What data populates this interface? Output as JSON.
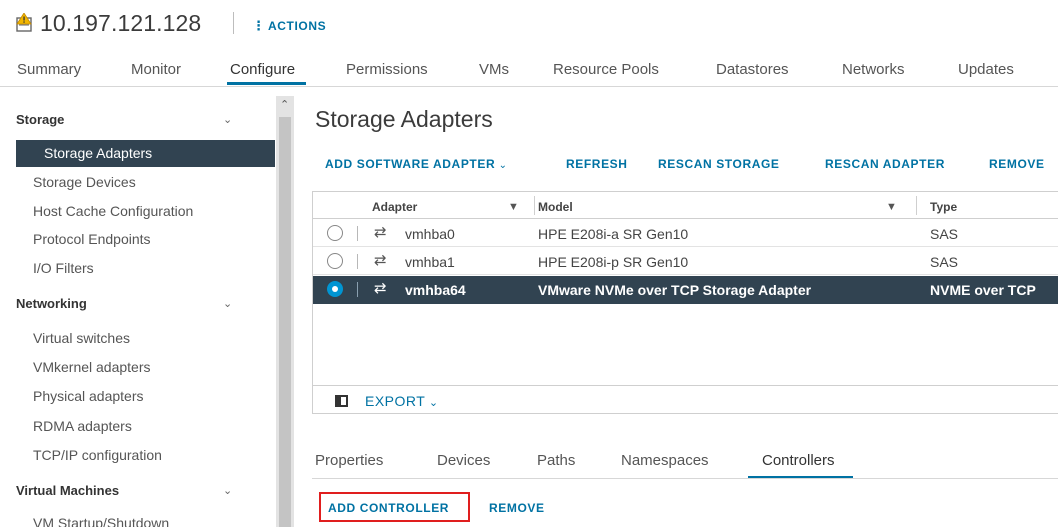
{
  "header": {
    "host_icon": "host-warning-icon",
    "host_name": "10.197.121.128",
    "actions_icon": "vertical-ellipsis-icon",
    "actions_label": "ACTIONS"
  },
  "main_tabs": [
    {
      "label": "Summary",
      "active": false
    },
    {
      "label": "Monitor",
      "active": false
    },
    {
      "label": "Configure",
      "active": true
    },
    {
      "label": "Permissions",
      "active": false
    },
    {
      "label": "VMs",
      "active": false
    },
    {
      "label": "Resource Pools",
      "active": false
    },
    {
      "label": "Datastores",
      "active": false
    },
    {
      "label": "Networks",
      "active": false
    },
    {
      "label": "Updates",
      "active": false
    }
  ],
  "sidebar": {
    "sections": [
      {
        "label": "Storage",
        "expanded": true,
        "items": [
          "Storage Adapters",
          "Storage Devices",
          "Host Cache Configuration",
          "Protocol Endpoints",
          "I/O Filters"
        ]
      },
      {
        "label": "Networking",
        "expanded": true,
        "items": [
          "Virtual switches",
          "VMkernel adapters",
          "Physical adapters",
          "RDMA adapters",
          "TCP/IP configuration"
        ]
      },
      {
        "label": "Virtual Machines",
        "expanded": true,
        "items": [
          "VM Startup/Shutdown"
        ]
      }
    ],
    "selected": "Storage Adapters"
  },
  "content": {
    "title": "Storage Adapters",
    "toolbar": {
      "add_software_adapter": "ADD SOFTWARE ADAPTER",
      "refresh": "REFRESH",
      "rescan_storage": "RESCAN STORAGE",
      "rescan_adapter": "RESCAN ADAPTER",
      "remove": "REMOVE"
    },
    "grid": {
      "columns": [
        "Adapter",
        "Model",
        "Type"
      ],
      "rows": [
        {
          "adapter": "vmhba0",
          "model": "HPE E208i-a SR Gen10",
          "type": "SAS",
          "selected": false
        },
        {
          "adapter": "vmhba1",
          "model": "HPE E208i-p SR Gen10",
          "type": "SAS",
          "selected": false
        },
        {
          "adapter": "vmhba64",
          "model": "VMware NVMe over TCP Storage Adapter",
          "type": "NVME over TCP",
          "selected": true
        }
      ],
      "export_label": "EXPORT"
    },
    "sub_tabs": [
      {
        "label": "Properties",
        "active": false
      },
      {
        "label": "Devices",
        "active": false
      },
      {
        "label": "Paths",
        "active": false
      },
      {
        "label": "Namespaces",
        "active": false
      },
      {
        "label": "Controllers",
        "active": true
      }
    ],
    "controller_actions": {
      "add_controller": "ADD CONTROLLER",
      "remove": "REMOVE"
    }
  },
  "colors": {
    "accent": "#0072a3",
    "selected_bg": "#314351",
    "radio_selected": "#0095d3",
    "highlight_box": "#e01e1e"
  }
}
